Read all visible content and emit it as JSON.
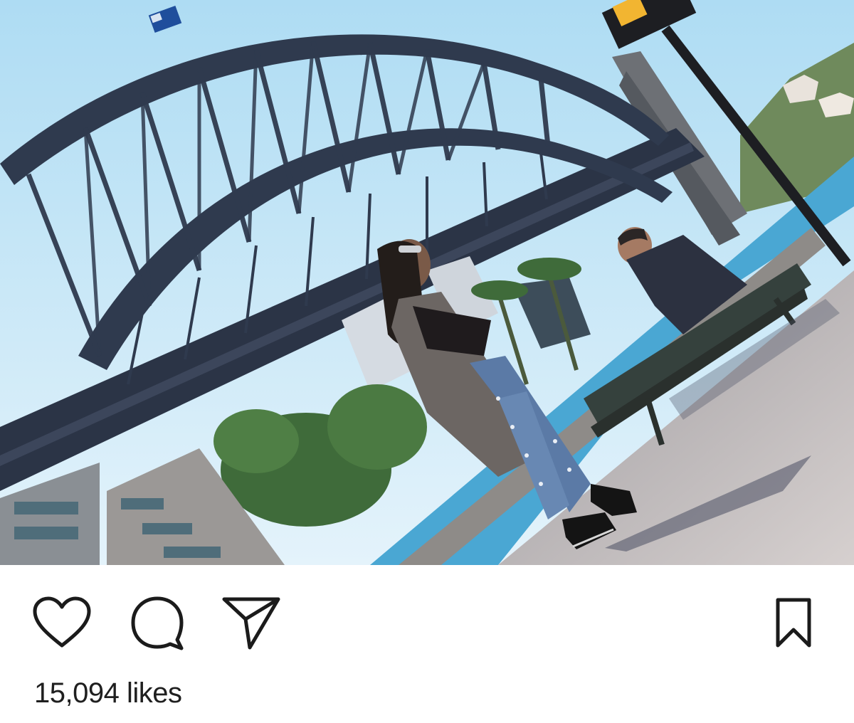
{
  "post": {
    "photo": {
      "alt": "",
      "colors": {
        "sky": "#bfe3f5",
        "bridge": "#2f3a4e",
        "pavement": "#b9b4b6",
        "water": "#4aa7d3",
        "trees": "#3f6b3a"
      }
    },
    "actions": {
      "like_icon": "heart-outline-icon",
      "comment_icon": "comment-bubble-icon",
      "share_icon": "paper-plane-icon",
      "save_icon": "bookmark-outline-icon"
    },
    "likes_text": "15,094 likes"
  }
}
